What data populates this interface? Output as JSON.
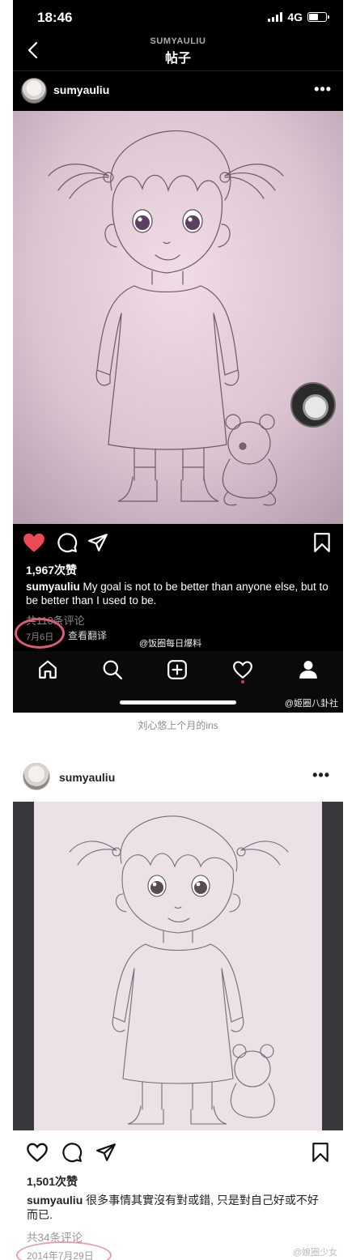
{
  "shot1": {
    "status": {
      "time": "18:46",
      "network": "4G"
    },
    "nav": {
      "subtitle": "SUMYAULIU",
      "title": "帖子"
    },
    "post": {
      "username": "sumyauliu",
      "likes": "1,967次赞",
      "caption_user": "sumyauliu",
      "caption_text": " My goal is not to be better than anyone else, but to be better than I used to be.",
      "comments": "共110条评论",
      "date": "7月6日",
      "translate": "查看翻译",
      "liked": true
    },
    "watermark_top": "@饭圈每日爆料",
    "watermark_bottom": "@姬圈八卦社",
    "tabs": [
      "home",
      "search",
      "new-post",
      "activity",
      "profile"
    ]
  },
  "between_caption": "刘心悠上个月的ins",
  "shot2": {
    "post": {
      "username": "sumyauliu",
      "likes": "1,501次赞",
      "caption_user": "sumyauliu",
      "caption_text": " 很多事情其實沒有對或錯, 只是對自己好或不好而已.",
      "comments": "共34条评论",
      "date": "2014年7月29日",
      "liked": false
    },
    "watermark": "@娘圈少女"
  },
  "colors": {
    "like_red": "#ed4956",
    "circle_pink": "#e05a78"
  }
}
